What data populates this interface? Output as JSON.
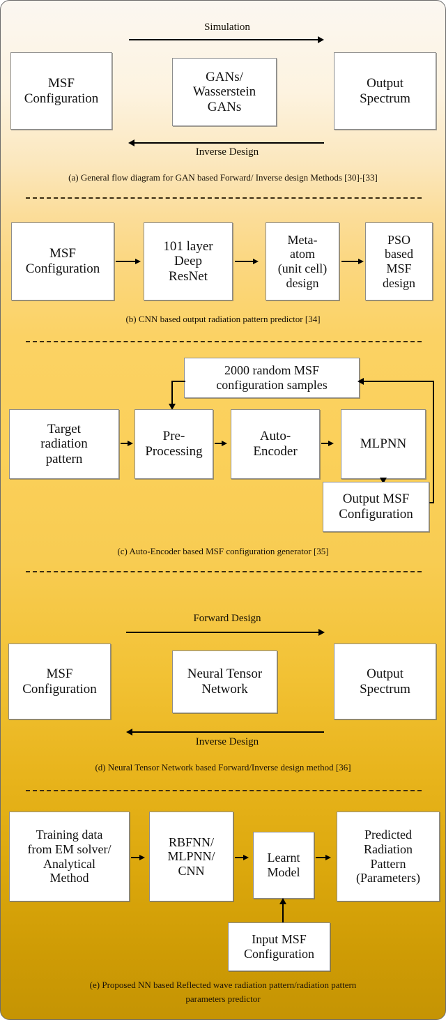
{
  "figure": {
    "panels": [
      {
        "id": "a",
        "caption": "(a) General flow diagram for GAN based Forward/ Inverse design Methods [30]-[33]",
        "boxes": [
          {
            "name": "msf-configuration",
            "lines": [
              "MSF",
              "Configuration"
            ]
          },
          {
            "name": "gans-wasserstein-gans",
            "lines": [
              "GANs/",
              "Wasserstein",
              "GANs"
            ]
          },
          {
            "name": "output-spectrum",
            "lines": [
              "Output",
              "Spectrum"
            ]
          }
        ],
        "arrows": [
          {
            "name": "simulation-arrow",
            "label": "Simulation",
            "direction": "right"
          },
          {
            "name": "inverse-design-arrow",
            "label": "Inverse Design",
            "direction": "left"
          }
        ]
      },
      {
        "id": "b",
        "caption": "(b) CNN based output radiation pattern predictor [34]",
        "boxes": [
          {
            "name": "msf-configuration",
            "lines": [
              "MSF",
              "Configuration"
            ]
          },
          {
            "name": "deep-resnet",
            "lines": [
              "101 layer",
              "Deep",
              "ResNet"
            ]
          },
          {
            "name": "meta-atom-design",
            "lines": [
              "Meta-",
              "atom",
              "(unit cell)",
              "design"
            ]
          },
          {
            "name": "pso-based-msf-design",
            "lines": [
              "PSO",
              "based",
              "MSF",
              "design"
            ]
          }
        ]
      },
      {
        "id": "c",
        "caption": "(c) Auto-Encoder based MSF configuration generator [35]",
        "boxes": [
          {
            "name": "random-msf-samples",
            "lines": [
              "2000 random MSF",
              "configuration samples"
            ]
          },
          {
            "name": "target-radiation-pattern",
            "lines": [
              "Target",
              "radiation",
              "pattern"
            ]
          },
          {
            "name": "pre-processing",
            "lines": [
              "Pre-",
              "Processing"
            ]
          },
          {
            "name": "auto-encoder",
            "lines": [
              "Auto-",
              "Encoder"
            ]
          },
          {
            "name": "mlpnn",
            "lines": [
              "MLPNN"
            ]
          },
          {
            "name": "output-msf-configuration",
            "lines": [
              "Output MSF",
              "Configuration"
            ]
          }
        ]
      },
      {
        "id": "d",
        "caption": "(d) Neural Tensor Network based Forward/Inverse design method [36]",
        "boxes": [
          {
            "name": "msf-configuration",
            "lines": [
              "MSF",
              "Configuration"
            ]
          },
          {
            "name": "neural-tensor-network",
            "lines": [
              "Neural Tensor",
              "Network"
            ]
          },
          {
            "name": "output-spectrum",
            "lines": [
              "Output",
              "Spectrum"
            ]
          }
        ],
        "arrows": [
          {
            "name": "forward-design-arrow",
            "label": "Forward Design",
            "direction": "right"
          },
          {
            "name": "inverse-design-arrow",
            "label": "Inverse Design",
            "direction": "left"
          }
        ]
      },
      {
        "id": "e",
        "caption_line1": "(e) Proposed NN based Reflected wave radiation pattern/radiation pattern",
        "caption_line2": "parameters predictor",
        "boxes": [
          {
            "name": "training-data",
            "lines": [
              "Training data",
              "from EM solver/",
              "Analytical",
              "Method"
            ]
          },
          {
            "name": "rbfnn-mlpnn-cnn",
            "lines": [
              "RBFNN/",
              "MLPNN/",
              "CNN"
            ]
          },
          {
            "name": "learnt-model",
            "lines": [
              "Learnt",
              "Model"
            ]
          },
          {
            "name": "predicted-radiation-pattern",
            "lines": [
              "Predicted",
              "Radiation",
              "Pattern",
              "(Parameters)"
            ]
          },
          {
            "name": "input-msf-configuration",
            "lines": [
              "Input MSF",
              "Configuration"
            ]
          }
        ]
      }
    ]
  },
  "colors": {
    "background_top": "#fbf7f1",
    "background_mid": "#fbd05a",
    "background_bottom": "#c59404",
    "box_fill": "#ffffff",
    "box_border": "#8d8d8d",
    "stroke": "#000000"
  }
}
